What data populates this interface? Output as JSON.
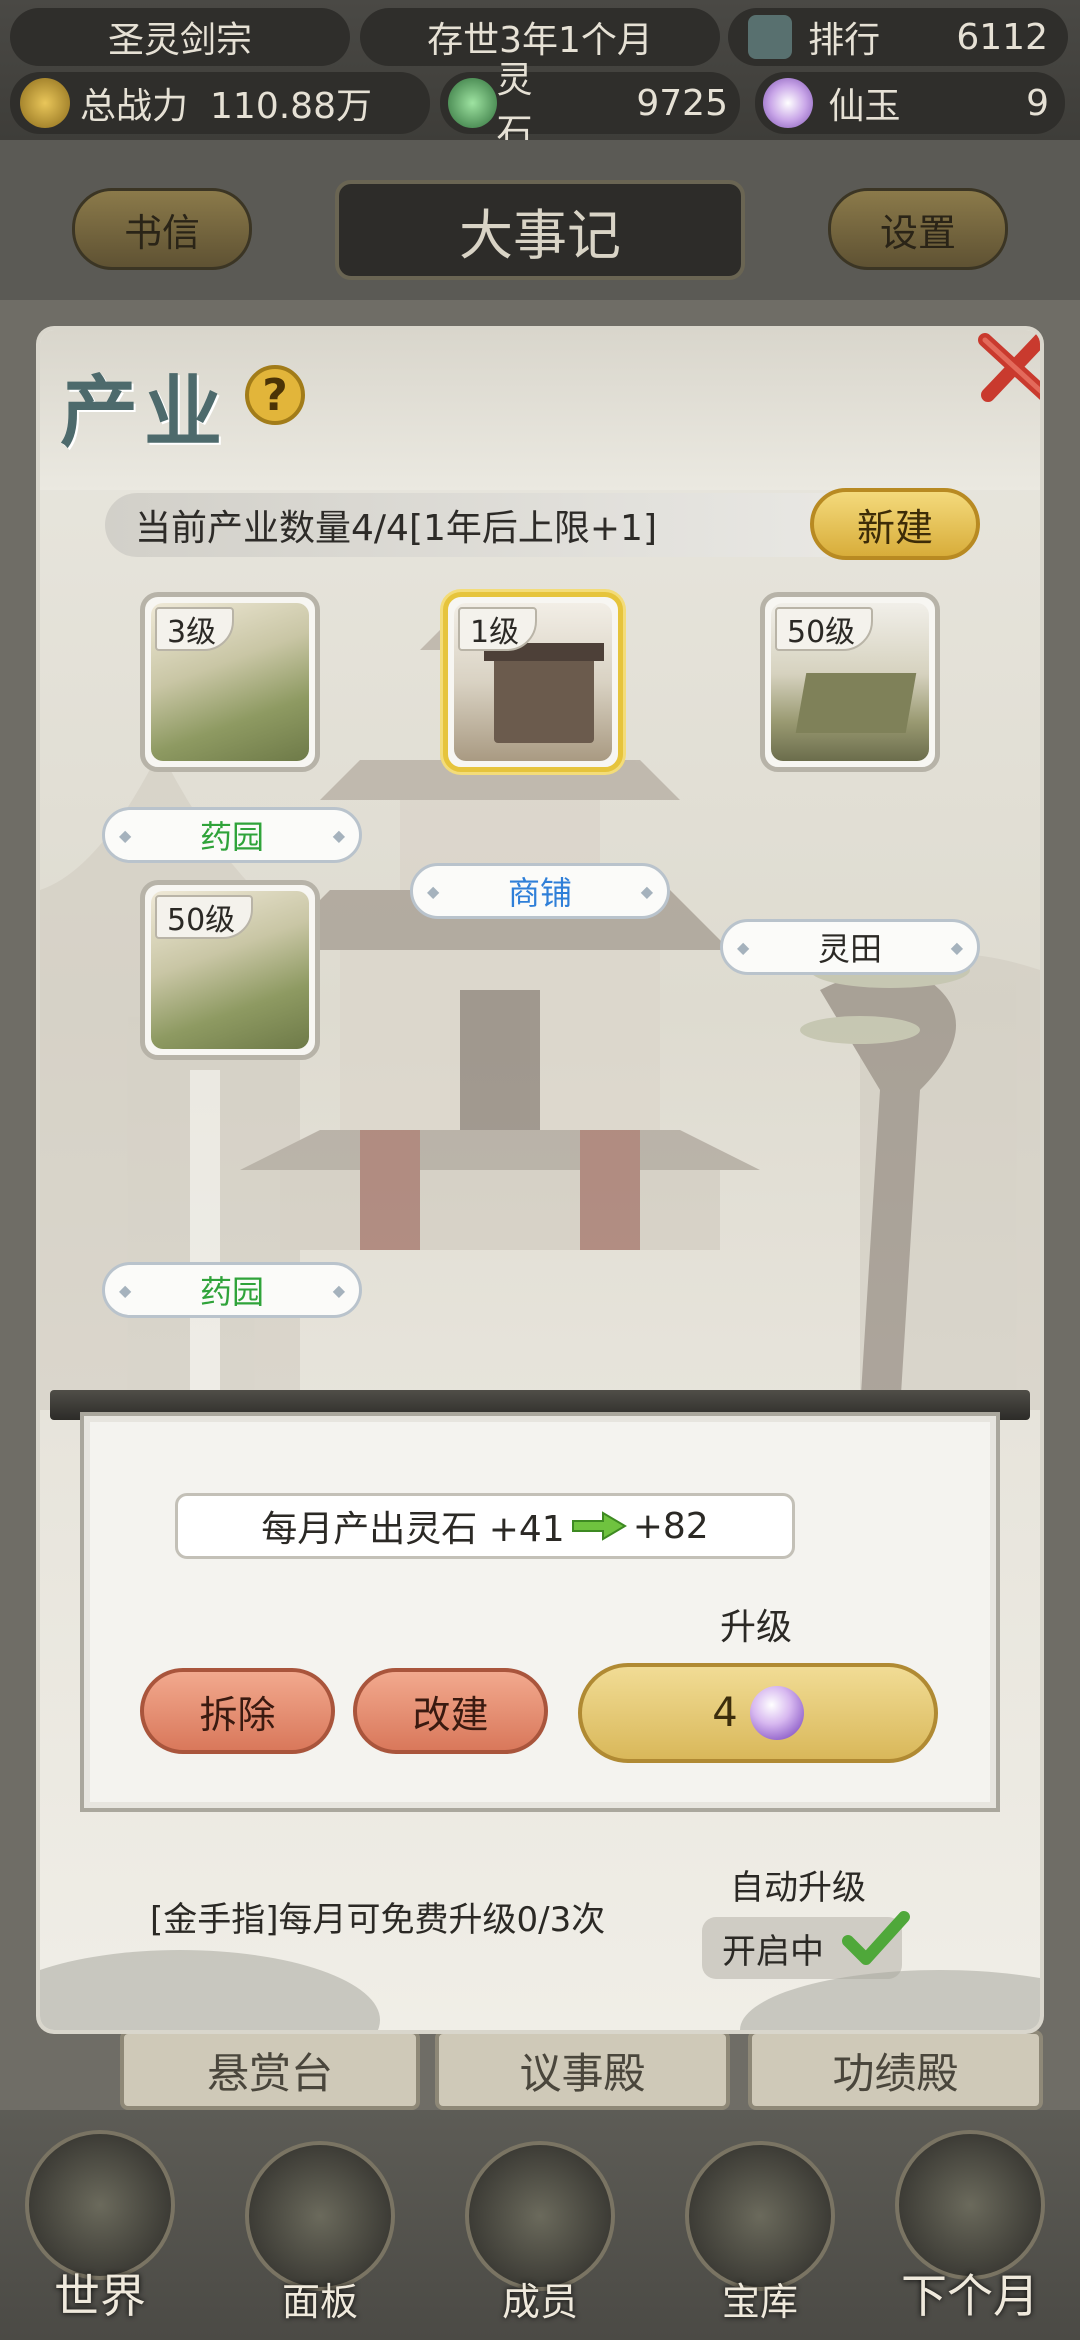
{
  "header": {
    "sect_name": "圣灵剑宗",
    "time": "存世3年1个月",
    "rank_label": "排行",
    "rank_value": "6112",
    "power_label": "总战力",
    "power_value": "110.88万",
    "spirit_stone_label": "灵石",
    "spirit_stone_value": "9725",
    "jade_label": "仙玉",
    "jade_value": "9"
  },
  "tabs": {
    "left": "书信",
    "center": "大事记",
    "right": "设置"
  },
  "panel": {
    "title": "产业",
    "count_text": "当前产业数量4/4[1年后上限+1]",
    "new_button": "新建",
    "slots": [
      {
        "level": "3级",
        "name": "药园",
        "name_color": "green",
        "selected": false
      },
      {
        "level": "1级",
        "name": "商铺",
        "name_color": "blue",
        "selected": true
      },
      {
        "level": "50级",
        "name": "灵田",
        "name_color": "dark",
        "selected": false
      },
      {
        "level": "50级",
        "name": "药园",
        "name_color": "green",
        "selected": false
      }
    ],
    "output_prefix": "每月产出灵石 +41",
    "output_suffix": "+82",
    "upgrade_label": "升级",
    "demolish_button": "拆除",
    "rebuild_button": "改建",
    "upgrade_cost": "4",
    "goldfinger_text": "[金手指]每月可免费升级0/3次",
    "auto_upgrade_label": "自动升级",
    "auto_upgrade_state": "开启中"
  },
  "background_buildings": [
    "悬赏台",
    "议事殿",
    "功绩殿"
  ],
  "bottom_nav": [
    "世界",
    "面板",
    "成员",
    "宝库",
    "下个月"
  ],
  "colors": {
    "accent_gold": "#e6c43c",
    "green_text": "#2fa33a",
    "blue_text": "#2f7fd8"
  }
}
